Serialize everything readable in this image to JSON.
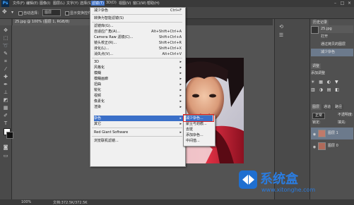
{
  "menubar": {
    "items": [
      "文件(F)",
      "编辑(E)",
      "图像(I)",
      "图层(L)",
      "文字(Y)",
      "选择(S)",
      "滤镜(T)",
      "3D(D)",
      "视图(V)",
      "窗口(W)",
      "帮助(H)"
    ]
  },
  "options_bar": {
    "auto_select_label": "自动选择：",
    "layer_select": "图层",
    "show_transform_label": "显示变换控件"
  },
  "document_tab": {
    "label": "25.jpg @ 100% (图层 1, RGB/8)"
  },
  "status_bar": {
    "zoom": "100%",
    "doc_info": "文档:372.5K/372.5K"
  },
  "filter_menu": {
    "items": [
      {
        "label": "减少杂色",
        "shortcut": "Ctrl+F"
      },
      {
        "label": "转换为智能滤镜(S)",
        "shortcut": ""
      },
      {
        "label": "滤镜库(G)...",
        "shortcut": ""
      },
      {
        "label": "自适应广角(A)...",
        "shortcut": "Alt+Shift+Ctrl+A"
      },
      {
        "label": "Camera Raw 滤镜(C)...",
        "shortcut": "Shift+Ctrl+A"
      },
      {
        "label": "镜头校正(R)...",
        "shortcut": "Shift+Ctrl+R"
      },
      {
        "label": "液化(L)...",
        "shortcut": "Shift+Ctrl+X"
      },
      {
        "label": "消失点(V)...",
        "shortcut": "Alt+Ctrl+V"
      },
      {
        "label": "3D",
        "submenu": true
      },
      {
        "label": "风格化",
        "submenu": true
      },
      {
        "label": "模糊",
        "submenu": true
      },
      {
        "label": "模糊画廊",
        "submenu": true
      },
      {
        "label": "扭曲",
        "submenu": true
      },
      {
        "label": "锐化",
        "submenu": true
      },
      {
        "label": "视频",
        "submenu": true
      },
      {
        "label": "像素化",
        "submenu": true
      },
      {
        "label": "渲染",
        "submenu": true
      },
      {
        "label": "杂色",
        "submenu": true,
        "highlighted": true
      },
      {
        "label": "其它",
        "submenu": true
      },
      {
        "label": "Red Giant Software",
        "submenu": true
      },
      {
        "label": "浏览联机滤镜...",
        "shortcut": ""
      }
    ]
  },
  "noise_submenu": {
    "items": [
      {
        "label": "减少杂色...",
        "highlighted": true
      },
      {
        "label": "蒙尘与划痕..."
      },
      {
        "label": "去斑"
      },
      {
        "label": "添加杂色..."
      },
      {
        "label": "中间值..."
      }
    ]
  },
  "history_panel": {
    "tab": "历史记录",
    "items": [
      "25.jpg",
      "打开",
      "通过拷贝的图层",
      "减少杂色"
    ]
  },
  "adjustments_panel": {
    "tab": "调整",
    "title": "添加调整"
  },
  "layers_panel": {
    "tabs": [
      "图层",
      "通道",
      "路径"
    ],
    "blend_mode": "正常",
    "opacity_label": "不透明度:",
    "lock_label": "锁定:",
    "fill_label": "填充:",
    "layers": [
      "图层 1",
      "图层 0"
    ]
  },
  "watermark": {
    "brand": "系统盒",
    "url": "www.xitonghe.com"
  },
  "colors": {
    "menu_highlight": "#3a6fc8",
    "submenu_outline": "#e02020",
    "app_bg": "#535353"
  }
}
